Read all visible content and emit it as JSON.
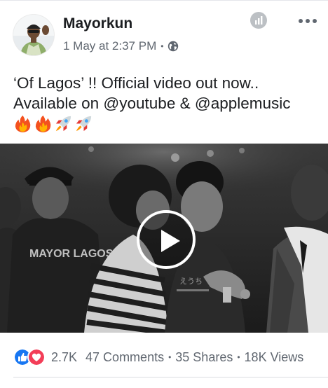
{
  "post": {
    "author": "Mayorkun",
    "timestamp": "1 May at 2:37 PM",
    "meta_separator": "•",
    "privacy_icon": "globe-icon",
    "caption_lines": [
      "‘Of Lagos’ !! Official video out now..",
      "Available on @youtube & @applemusic"
    ],
    "caption_emojis": [
      "fire",
      "fire",
      "rocket",
      "rocket"
    ],
    "video": {
      "hoodie_text": "MAYOR LAGOS",
      "play_icon": "play-icon"
    }
  },
  "engagement": {
    "reaction_icons": [
      "like-icon",
      "love-icon"
    ],
    "reactions_count": "2.7K",
    "comments": "47 Comments",
    "shares": "35 Shares",
    "views": "18K Views",
    "separator": "•"
  },
  "colors": {
    "like_blue": "#1877f2",
    "love_red": "#f33e58",
    "meta_gray": "#606770",
    "text": "#1c1e21"
  }
}
